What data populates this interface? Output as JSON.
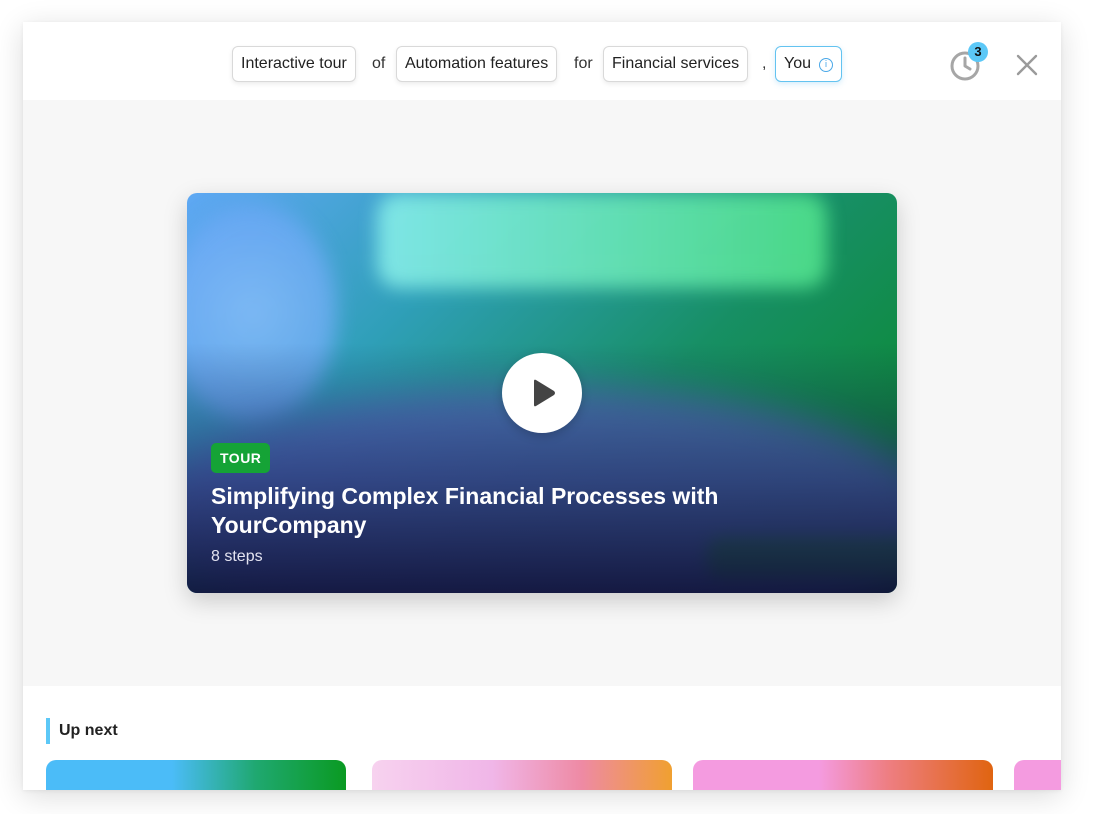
{
  "header": {
    "chips": [
      {
        "label": "Interactive tour"
      },
      {
        "label": "Automation features"
      },
      {
        "label": "Financial services"
      },
      {
        "label": "You"
      }
    ],
    "joiners": [
      "of",
      "for",
      ","
    ],
    "history_badge": "3"
  },
  "hero": {
    "tag": "TOUR",
    "title": "Simplifying Complex Financial Processes with YourCompany",
    "steps": "8 steps"
  },
  "up_next": {
    "heading": "Up next"
  },
  "colors": {
    "accent": "#5cc8f7",
    "tag_green": "#15a336",
    "stage_bg": "#f7f7f7"
  },
  "icons": [
    "info-icon",
    "history-clock-icon",
    "close-icon",
    "play-icon"
  ]
}
